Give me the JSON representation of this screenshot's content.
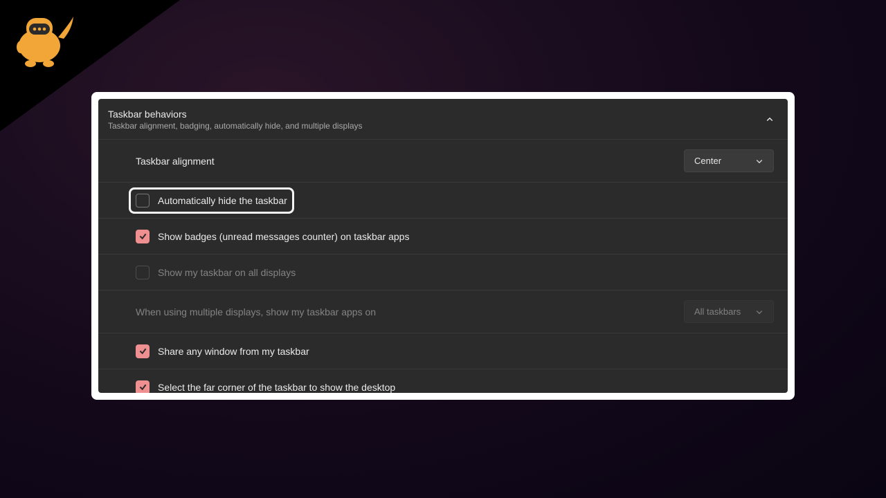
{
  "panel": {
    "title": "Taskbar behaviors",
    "subtitle": "Taskbar alignment, badging, automatically hide, and multiple displays"
  },
  "rows": {
    "alignment": {
      "label": "Taskbar alignment",
      "value": "Center"
    },
    "autohide": {
      "label": "Automatically hide the taskbar"
    },
    "badges": {
      "label": "Show badges (unread messages counter) on taskbar apps"
    },
    "alldisplays": {
      "label": "Show my taskbar on all displays"
    },
    "multidesc": {
      "label": "When using multiple displays, show my taskbar apps on",
      "value": "All taskbars"
    },
    "share": {
      "label": "Share any window from my taskbar"
    },
    "farcorner": {
      "label": "Select the far corner of the taskbar to show the desktop"
    }
  }
}
